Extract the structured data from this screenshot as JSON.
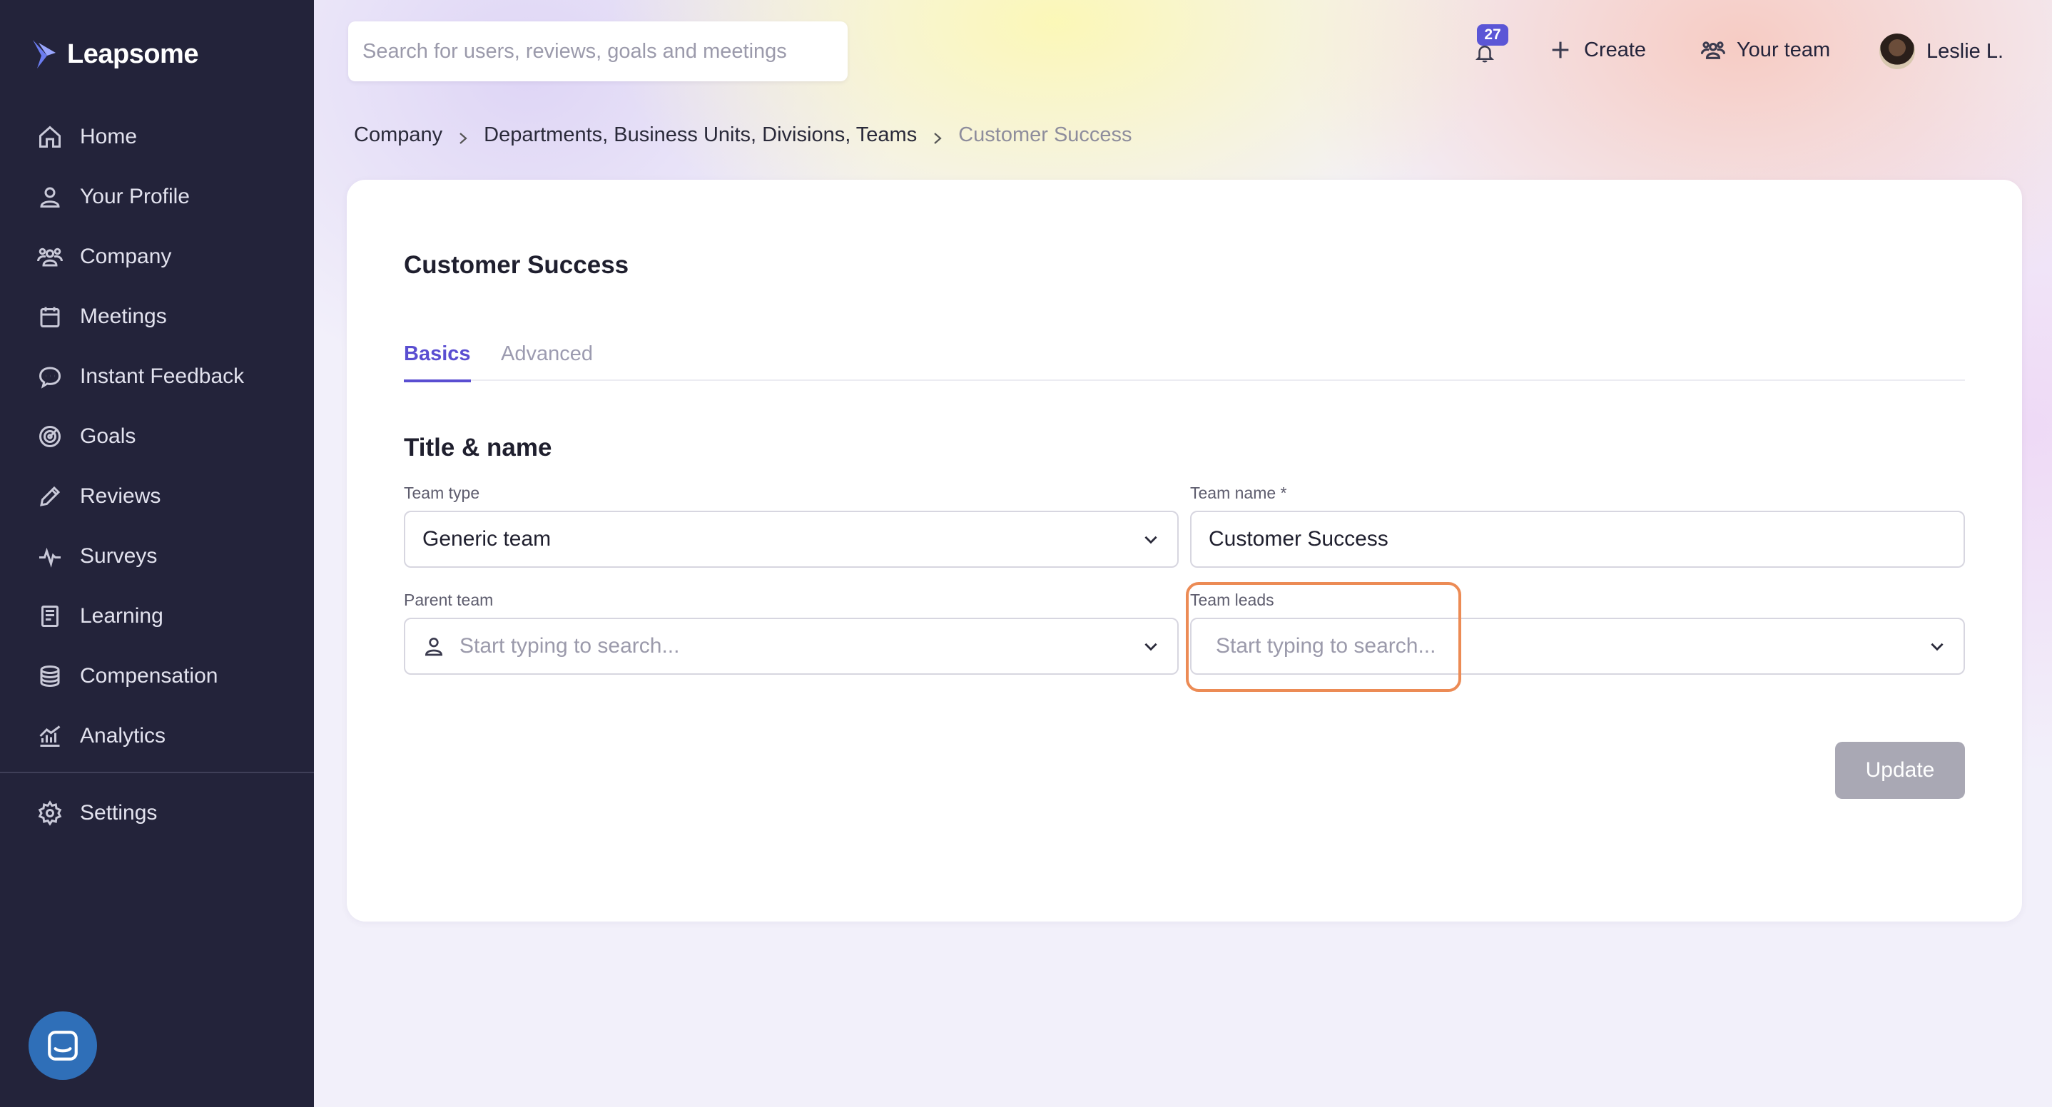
{
  "app": {
    "logo_text": "Leapsome"
  },
  "sidebar": {
    "items": [
      {
        "label": "Home",
        "icon": "home-icon"
      },
      {
        "label": "Your Profile",
        "icon": "user-icon"
      },
      {
        "label": "Company",
        "icon": "people-icon"
      },
      {
        "label": "Meetings",
        "icon": "calendar-icon"
      },
      {
        "label": "Instant Feedback",
        "icon": "chat-icon"
      },
      {
        "label": "Goals",
        "icon": "target-icon"
      },
      {
        "label": "Reviews",
        "icon": "pencil-icon"
      },
      {
        "label": "Surveys",
        "icon": "pulse-icon"
      },
      {
        "label": "Learning",
        "icon": "book-icon"
      },
      {
        "label": "Compensation",
        "icon": "coins-icon"
      },
      {
        "label": "Analytics",
        "icon": "chart-icon"
      }
    ],
    "settings": {
      "label": "Settings",
      "icon": "gear-icon"
    }
  },
  "topbar": {
    "search_placeholder": "Search for users, reviews, goals and meetings",
    "notification_count": "27",
    "create_label": "Create",
    "your_team_label": "Your team",
    "user_name": "Leslie L."
  },
  "breadcrumb": {
    "items": [
      "Company",
      "Departments, Business Units, Divisions, Teams"
    ],
    "current": "Customer Success"
  },
  "card": {
    "title": "Customer Success",
    "tabs": {
      "basics": "Basics",
      "advanced": "Advanced"
    },
    "section_title": "Title & name",
    "team_type": {
      "label": "Team type",
      "value": "Generic team"
    },
    "team_name": {
      "label": "Team name *",
      "value": "Customer Success"
    },
    "parent_team": {
      "label": "Parent team",
      "placeholder": "Start typing to search..."
    },
    "team_leads": {
      "label": "Team leads",
      "placeholder": "Start typing to search..."
    },
    "update_label": "Update"
  },
  "colors": {
    "sidebar_bg": "#23233a",
    "accent": "#5a4ed1",
    "highlight": "#ec8b55",
    "update_disabled": "#a9a8b4",
    "chat_bubble": "#2f6fb8"
  }
}
